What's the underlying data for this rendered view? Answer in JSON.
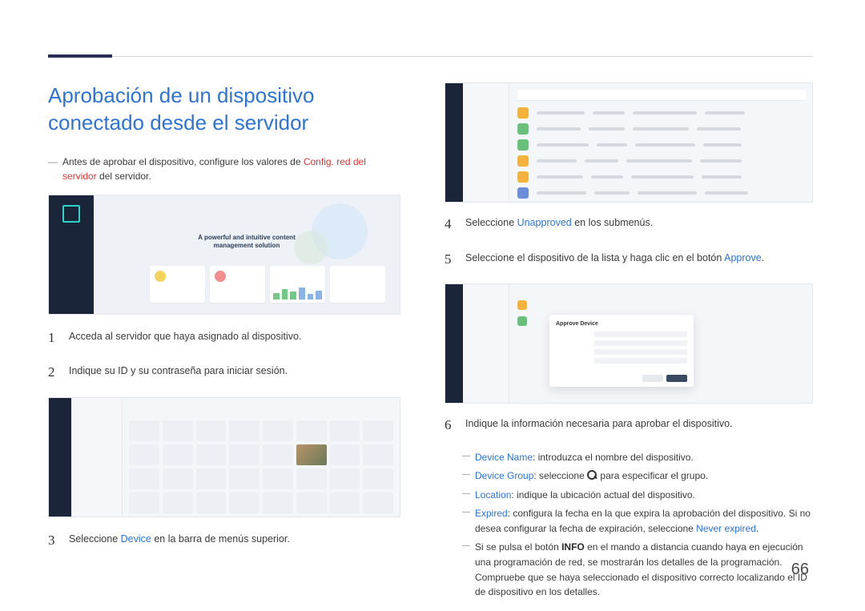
{
  "page_number": "66",
  "title": "Aprobación de un dispositivo conectado desde el servidor",
  "intro_pre": "Antes de aprobar el dispositivo, configure los valores de ",
  "intro_red": "Config. red del servidor",
  "intro_post": " del servidor.",
  "hero_tagline": "A powerful and intuitive content management solution",
  "dialog_title": "Approve Device",
  "steps": {
    "s1": {
      "n": "1",
      "text": "Acceda al servidor que haya asignado al dispositivo."
    },
    "s2": {
      "n": "2",
      "text": "Indique su ID y su contraseña para iniciar sesión."
    },
    "s3": {
      "n": "3",
      "pre": "Seleccione ",
      "hl": "Device",
      "post": " en la barra de menús superior."
    },
    "s4": {
      "n": "4",
      "pre": "Seleccione ",
      "hl": "Unapproved",
      "post": " en los submenús."
    },
    "s5": {
      "n": "5",
      "pre": "Seleccione el dispositivo de la lista y haga clic en el botón ",
      "hl": "Approve",
      "post": "."
    },
    "s6": {
      "n": "6",
      "text": "Indique la información necesaria para aprobar el dispositivo."
    }
  },
  "sub": {
    "a": {
      "hl": "Device Name",
      "post": ": introduzca el nombre del dispositivo."
    },
    "b": {
      "hl": "Device Group",
      "mid1": ": seleccione ",
      "mid2": " para especificar el grupo."
    },
    "c": {
      "hl": "Location",
      "post": ": indique la ubicación actual del dispositivo."
    },
    "d": {
      "hl": "Expired",
      "mid": ": configura la fecha en la que expira la aprobación del dispositivo. Si no desea configurar la fecha de expiración, seleccione ",
      "hl2": "Never expired",
      "post": "."
    },
    "e": {
      "pre": "Si se pulsa el botón ",
      "bold": "INFO",
      "post": " en el mando a distancia cuando haya en ejecución una programación de red, se mostrarán los detalles de la programación. Compruebe que se haya seleccionado el dispositivo correcto localizando el ID de dispositivo en los detalles."
    }
  }
}
